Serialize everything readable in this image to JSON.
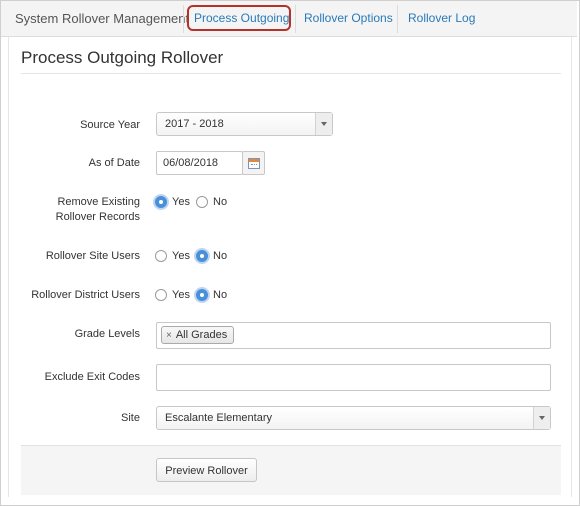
{
  "nav": {
    "title": "System Rollover Management",
    "tabs": [
      {
        "label": "Process Outgoing"
      },
      {
        "label": "Rollover Options"
      },
      {
        "label": "Rollover Log"
      }
    ]
  },
  "page": {
    "title": "Process Outgoing Rollover"
  },
  "form": {
    "source_year": {
      "label": "Source Year",
      "value": "2017 - 2018"
    },
    "as_of_date": {
      "label": "As of Date",
      "value": "06/08/2018"
    },
    "remove_existing": {
      "label_line1": "Remove Existing",
      "label_line2": "Rollover Records",
      "options": [
        {
          "label": "Yes",
          "selected": true
        },
        {
          "label": "No",
          "selected": false
        }
      ]
    },
    "rollover_site_users": {
      "label": "Rollover Site Users",
      "options": [
        {
          "label": "Yes",
          "selected": false
        },
        {
          "label": "No",
          "selected": true
        }
      ]
    },
    "rollover_district_users": {
      "label": "Rollover District Users",
      "options": [
        {
          "label": "Yes",
          "selected": false
        },
        {
          "label": "No",
          "selected": true
        }
      ]
    },
    "grade_levels": {
      "label": "Grade Levels",
      "tags": [
        {
          "label": "All Grades",
          "remove_glyph": "×"
        }
      ]
    },
    "exclude_exit_codes": {
      "label": "Exclude Exit Codes",
      "value": ""
    },
    "site": {
      "label": "Site",
      "value": "Escalante Elementary"
    }
  },
  "actions": {
    "preview_label": "Preview Rollover"
  },
  "colors": {
    "link": "#2a7ab8",
    "highlight": "#b5322a",
    "radio_on": "#4a90d9"
  }
}
